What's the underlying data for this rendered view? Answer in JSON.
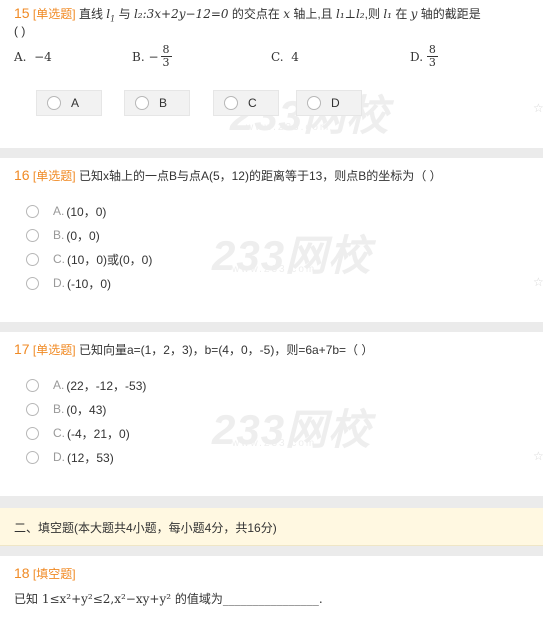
{
  "q15": {
    "num": "15",
    "type": "[单选题]",
    "text_pre": "直线",
    "l1": "l",
    "and": "与",
    "eq": "l₂:3x+2y−12=0",
    "text_mid": "的交点在",
    "xaxis": "x",
    "text_mid2": "轴上,且",
    "perp": "l₁⊥l₂",
    "text_mid3": ",则",
    "l1b": "l₁",
    "text_mid4": "在",
    "yaxis": "y",
    "text_end": "轴的截距是",
    "paren": "(        )",
    "options": [
      {
        "letter": "A.",
        "value": "−4"
      },
      {
        "letter": "B.",
        "value": "−8/3"
      },
      {
        "letter": "C.",
        "value": "4"
      },
      {
        "letter": "D.",
        "value": "8/3"
      }
    ],
    "answer_buttons": [
      "A",
      "B",
      "C",
      "D"
    ]
  },
  "q16": {
    "num": "16",
    "type": "[单选题]",
    "text": "已知x轴上的一点B与点A(5，12)的距离等于13，则点B的坐标为（        ）",
    "options": [
      {
        "letter": "A.",
        "value": "(10，0)"
      },
      {
        "letter": "B.",
        "value": "(0，0)"
      },
      {
        "letter": "C.",
        "value": "(10，0)或(0，0)"
      },
      {
        "letter": "D.",
        "value": "(-10，0)"
      }
    ]
  },
  "q17": {
    "num": "17",
    "type": "[单选题]",
    "text": "已知向量a=(1，2，3)，b=(4，0，-5)，则=6a+7b=（        ）",
    "options": [
      {
        "letter": "A.",
        "value": "(22，-12，-53)"
      },
      {
        "letter": "B.",
        "value": "(0，43)"
      },
      {
        "letter": "C.",
        "value": "(-4，21，0)"
      },
      {
        "letter": "D.",
        "value": "(12，53)"
      }
    ]
  },
  "section": {
    "title": "二、填空题(本大题共4小题，每小题4分，共16分)"
  },
  "q18": {
    "num": "18",
    "type": "[填空题]",
    "text": "已知 1≤x²+y²≤2,x²−xy+y² 的值域为________________."
  },
  "watermark": {
    "main": "233网校",
    "sub": "www.233.com"
  },
  "colors": {
    "accent": "#f08a24",
    "section_bg": "#fff8e1",
    "page_bg": "#ebebeb"
  },
  "icons": {
    "favorite": "star-icon",
    "option": "radio-icon"
  }
}
